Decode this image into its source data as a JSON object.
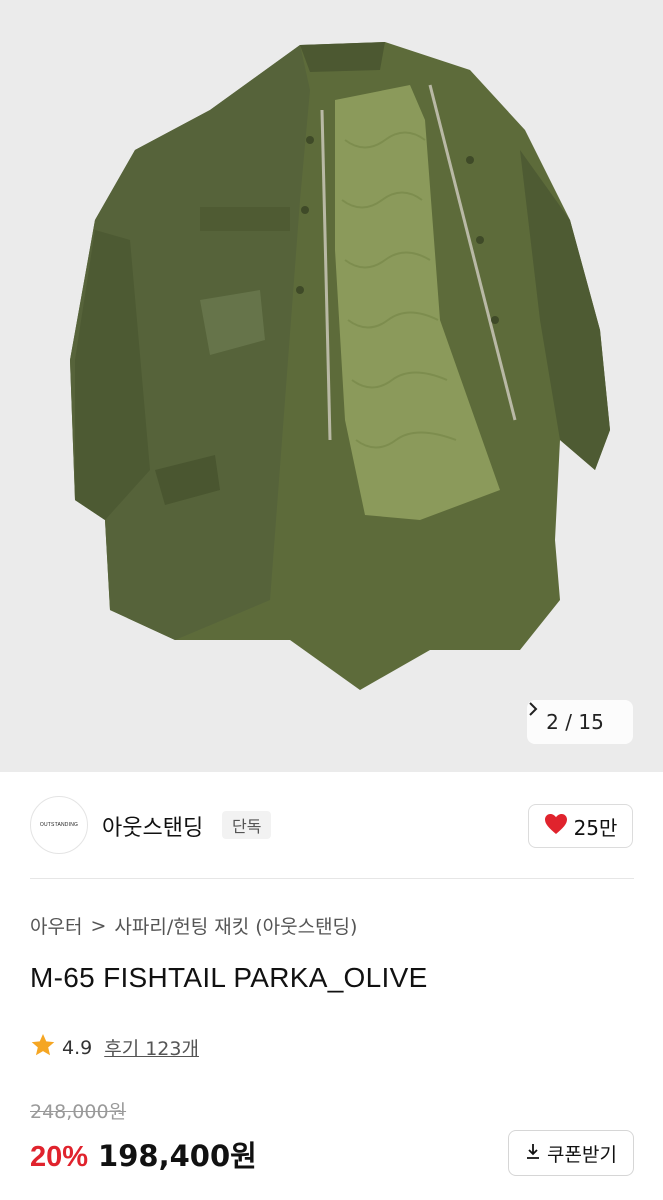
{
  "gallery": {
    "current": "2",
    "separator": "/",
    "total": "15",
    "next_icon": "chevron-right-icon"
  },
  "brand": {
    "logo_text": "OUTSTANDING",
    "name": "아웃스탠딩",
    "badge": "단독"
  },
  "like": {
    "icon": "heart-icon",
    "count": "25만",
    "color": "#e0232d"
  },
  "breadcrumb": {
    "parent": "아우터",
    "separator": ">",
    "current": "사파리/헌팅 재킷 (아웃스탠딩)"
  },
  "product": {
    "title": "M-65 FISHTAIL PARKA_OLIVE"
  },
  "rating": {
    "icon": "star-icon",
    "score": "4.9",
    "reviews_label": "후기 123개",
    "star_color": "#f5a623"
  },
  "price": {
    "original": "248,000원",
    "discount": "20%",
    "sale": "198,400원",
    "discount_color": "#e0232d"
  },
  "coupon": {
    "icon": "download-icon",
    "label": "쿠폰받기"
  }
}
